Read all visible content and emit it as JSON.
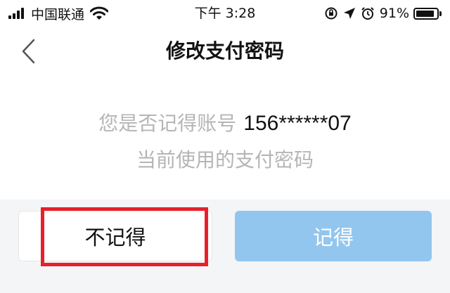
{
  "status_bar": {
    "carrier": "中国联通",
    "time": "下午 3:28",
    "battery_percent": "91%",
    "battery_level": 0.91,
    "icons": [
      "signal-icon",
      "wifi-icon",
      "screen-lock-icon",
      "location-icon",
      "alarm-icon",
      "battery-icon"
    ]
  },
  "nav": {
    "back_icon": "chevron-left-icon",
    "title": "修改支付密码"
  },
  "prompt": {
    "line1_prefix": "您是否记得账号",
    "account": "156******07",
    "line2": "当前使用的支付密码"
  },
  "actions": {
    "forgot_label": "不记得",
    "remember_label": "记得"
  },
  "colors": {
    "highlight": "#e8202a",
    "primary_button": "#93c6ee",
    "footer_background": "#f4f5f7",
    "muted_text": "#b5b5b5"
  }
}
